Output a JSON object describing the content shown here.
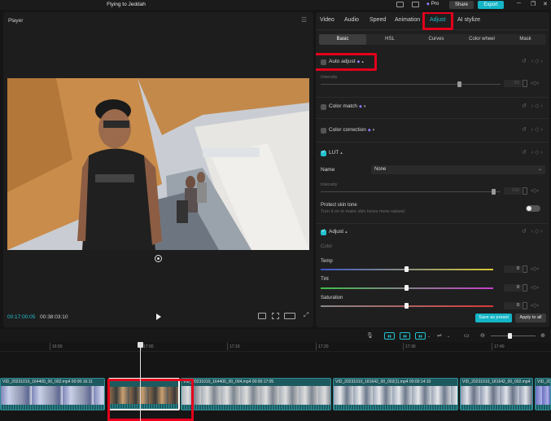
{
  "titlebar": {
    "title": "Flying to Jeddah",
    "pro": "Pro",
    "share": "Share",
    "export": "Export"
  },
  "player": {
    "title": "Player",
    "current_time": "00:17:00:05",
    "total_time": "00:38:03:10"
  },
  "tabs": [
    "Video",
    "Audio",
    "Speed",
    "Animation",
    "Adjust",
    "AI stylize"
  ],
  "active_tab": "Adjust",
  "subtabs": [
    "Basic",
    "HSL",
    "Curves",
    "Color wheel",
    "Mask"
  ],
  "active_subtab": "Basic",
  "auto_adjust": {
    "label": "Auto adjust",
    "intensity_label": "Intensity",
    "intensity_value": "83",
    "intensity_fraction": 0.83
  },
  "color_match": {
    "label": "Color match"
  },
  "color_correction": {
    "label": "Color correction"
  },
  "lut": {
    "label": "LUT",
    "name_label": "Name",
    "name_value": "None",
    "intensity_label": "Intensity",
    "intensity_value": "100"
  },
  "skin_tone": {
    "label": "Protect skin tone",
    "desc": "Turn it on to make skin tones more natural."
  },
  "adjust": {
    "label": "Adjust",
    "color_label": "Color",
    "sliders": [
      {
        "label": "Temp",
        "value": "0"
      },
      {
        "label": "Tint",
        "value": "0"
      },
      {
        "label": "Saturation",
        "value": "0"
      }
    ]
  },
  "buttons": {
    "save_preset": "Save as preset",
    "apply_all": "Apply to all"
  },
  "ruler_ticks": [
    "16:50",
    "17:00",
    "17:10",
    "17:20",
    "17:30",
    "17:40"
  ],
  "clips": [
    {
      "label": "VID_20231010_164400_00_002.mp4  00:00:16:11"
    },
    {
      "label": ""
    },
    {
      "label": "VID_20231010_164400_00_004.mp4  00:00:17:05"
    },
    {
      "label": "VID_20231010_181642_00_002(1).mp4  00:00:14:10"
    },
    {
      "label": "VID_20231010_181642_00_002.mp4"
    },
    {
      "label": "VID_20"
    }
  ],
  "colors": {
    "accent": "#22c1cf",
    "highlight": "#e3001b",
    "clip": "#1d5a5f"
  }
}
